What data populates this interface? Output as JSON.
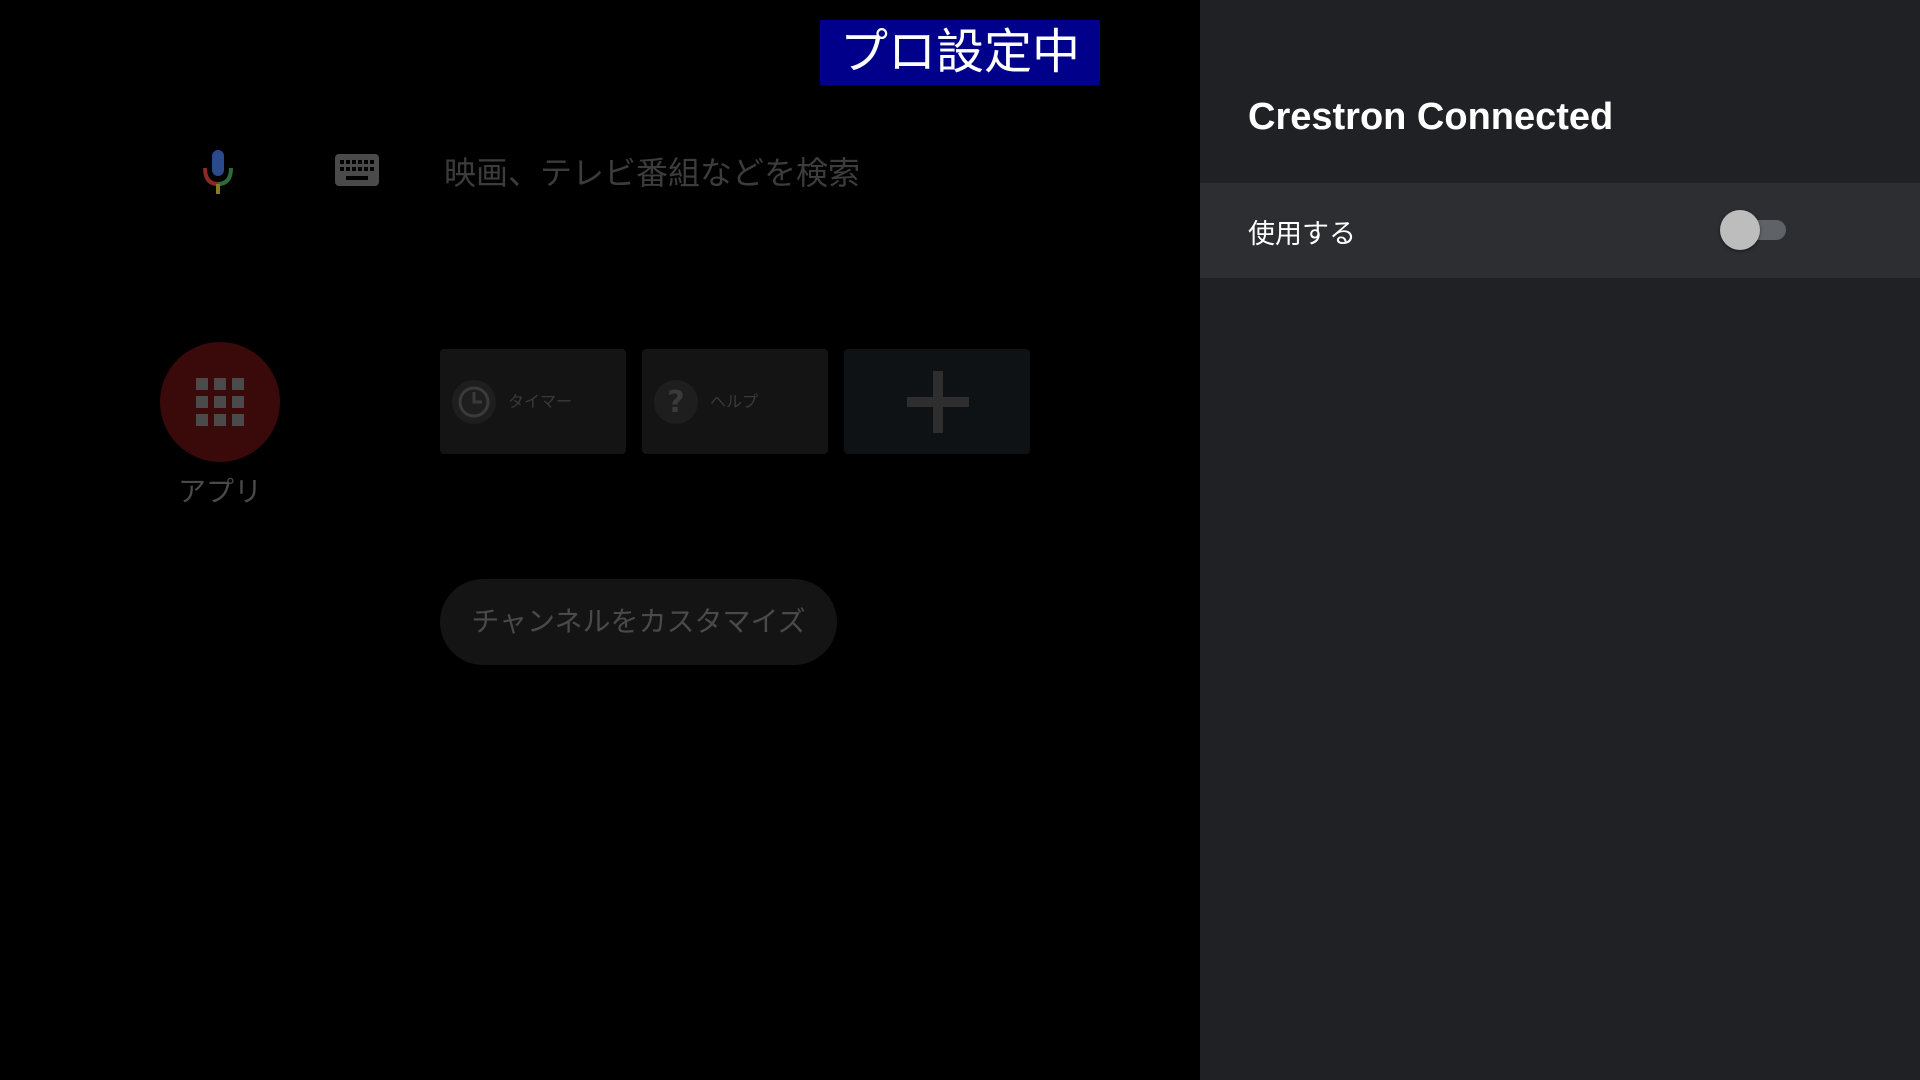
{
  "badge": {
    "label": "プロ設定中",
    "background": "#00008a"
  },
  "search": {
    "mic_icon": "mic-icon",
    "keyboard_icon": "keyboard-icon",
    "placeholder": "映画、テレビ番組などを検索"
  },
  "apps": {
    "label": "アプリ",
    "icon": "apps-grid-icon",
    "accent": "#3a0a0a"
  },
  "tiles": [
    {
      "label": "タイマー",
      "icon": "timer-icon"
    },
    {
      "label": "ヘルプ",
      "icon": "help-icon"
    },
    {
      "label": "",
      "icon": "plus-icon"
    }
  ],
  "customize_channels": {
    "label": "チャンネルをカスタマイズ"
  },
  "panel": {
    "title": "Crestron Connected",
    "rows": [
      {
        "label": "使用する",
        "toggle_on": false
      }
    ],
    "background": "#202124"
  }
}
